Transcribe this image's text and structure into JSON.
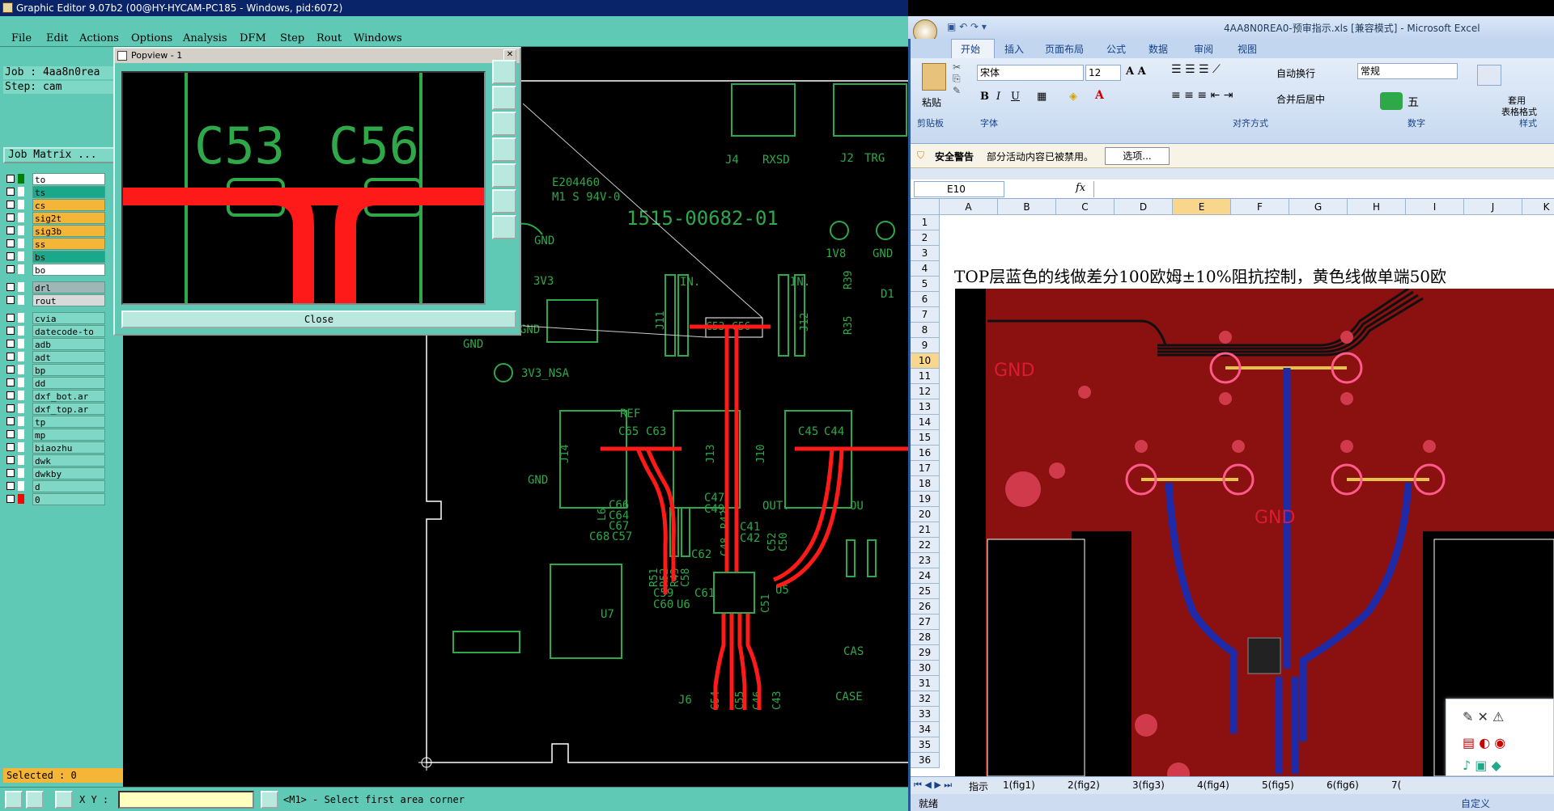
{
  "ge": {
    "title": "Graphic Editor 9.07b2 (00@HY-HYCAM-PC185 - Windows, pid:6072)",
    "menu": [
      "File",
      "Edit",
      "Actions",
      "Options",
      "Analysis",
      "DFM",
      "Step",
      "Rout",
      "Windows"
    ],
    "job": "Job : 4aa8n0rea",
    "step": "Step: cam",
    "job_matrix": "Job Matrix ...",
    "layers": [
      {
        "name": "to",
        "color": "#ffffff",
        "sw": "#008000"
      },
      {
        "name": "ts",
        "color": "#1aa88a",
        "sw": "#ffffff"
      },
      {
        "name": "cs",
        "color": "#f5b537",
        "sw": "#ffffff"
      },
      {
        "name": "sig2t",
        "color": "#f5b537",
        "sw": "#ffffff"
      },
      {
        "name": "sig3b",
        "color": "#f5b537",
        "sw": "#ffffff"
      },
      {
        "name": "ss",
        "color": "#f5b537",
        "sw": "#ffffff"
      },
      {
        "name": "bs",
        "color": "#1aa88a",
        "sw": "#ffffff"
      },
      {
        "name": "bo",
        "color": "#ffffff",
        "sw": "#ffffff"
      },
      {
        "name": "drl",
        "color": "#9eb6b6",
        "sw": "#ffffff"
      },
      {
        "name": "rout",
        "color": "#d9d9d9",
        "sw": "#ffffff"
      },
      {
        "name": "cvia",
        "color": "#7fd7c6",
        "sw": "#ffffff"
      },
      {
        "name": "datecode-to",
        "color": "#7fd7c6",
        "sw": "#ffffff"
      },
      {
        "name": "adb",
        "color": "#7fd7c6",
        "sw": "#ffffff"
      },
      {
        "name": "adt",
        "color": "#7fd7c6",
        "sw": "#ffffff"
      },
      {
        "name": "bp",
        "color": "#7fd7c6",
        "sw": "#ffffff"
      },
      {
        "name": "dd",
        "color": "#7fd7c6",
        "sw": "#ffffff"
      },
      {
        "name": "dxf_bot.ar",
        "color": "#7fd7c6",
        "sw": "#ffffff"
      },
      {
        "name": "dxf_top.ar",
        "color": "#7fd7c6",
        "sw": "#ffffff"
      },
      {
        "name": "tp",
        "color": "#7fd7c6",
        "sw": "#ffffff"
      },
      {
        "name": "mp",
        "color": "#7fd7c6",
        "sw": "#ffffff"
      },
      {
        "name": "biaozhu",
        "color": "#7fd7c6",
        "sw": "#ffffff"
      },
      {
        "name": "dwk",
        "color": "#7fd7c6",
        "sw": "#ffffff"
      },
      {
        "name": "dwkby",
        "color": "#7fd7c6",
        "sw": "#ffffff"
      },
      {
        "name": "d",
        "color": "#7fd7c6",
        "sw": "#ffffff"
      },
      {
        "name": "0",
        "color": "#7fd7c6",
        "sw": "#ff0000"
      }
    ],
    "selected": "Selected : 0",
    "xy_label": "X Y :",
    "prompt": "<M1> - Select first area corner",
    "popview_title": "Popview - 1",
    "popview_close": "Close",
    "pv_labels": [
      "C53",
      "C56"
    ],
    "board_labels": {
      "j4": "J4",
      "rxsd": "RXSD",
      "j2": "J2",
      "trg": "TRG",
      "pn": "1515-00682-01",
      "e2": "E204460",
      "m1": "M1 S 94V-0",
      "gnd1": "GND",
      "v1v8": "1V8",
      "gnd2": "GND",
      "v3v3": "3V3",
      "in1": "IN.",
      "in2": "IN.",
      "r39": "R39",
      "d1": "D1",
      "gnd3": "GND",
      "gnd4": "GND",
      "v3nsa": "3V3_NSA",
      "j11": "J11",
      "j12": "J12",
      "r35": "R35",
      "c53": "C53",
      "c56": "C56",
      "ref": "REF",
      "c65": "C65",
      "c63": "C63",
      "c45": "C45",
      "c44": "C44",
      "j14": "J14",
      "j13": "J13",
      "j10": "J10",
      "gnd5": "GND",
      "c66": "C66",
      "c64": "C64",
      "c67": "C67",
      "c68": "C68",
      "c57": "C57",
      "l6": "L6",
      "c47": "C47",
      "c49": "C49",
      "out": "OUT.",
      "ou": "OU",
      "c41": "C41",
      "c42": "C42",
      "c52": "C52",
      "c50": "C50",
      "c62": "C62",
      "c48": "C48",
      "r42": "R42",
      "r51": "R51",
      "r52": "R52",
      "r43": "R43",
      "c58": "C58",
      "c59": "C59",
      "c60": "C60",
      "u6": "U6",
      "c61": "C61",
      "c51": "C51",
      "u5": "U5",
      "u7": "U7",
      "c54": "C54",
      "c55": "C55",
      "c46": "C46",
      "c43": "C43",
      "j6": "J6",
      "cas": "CAS",
      "case": "CASE"
    }
  },
  "xl": {
    "title": "4AA8N0REA0-预审指示.xls [兼容模式] - Microsoft Excel",
    "tabs": [
      "开始",
      "插入",
      "页面布局",
      "公式",
      "数据",
      "审阅",
      "视图"
    ],
    "paste": "粘贴",
    "font_name": "宋体",
    "font_size": "12",
    "wrap": "自动换行",
    "merge": "合并后居中",
    "numfmt": "常规",
    "style_btn": "套用",
    "style_btn2": "表格格式",
    "groups": [
      "剪贴板",
      "字体",
      "对齐方式",
      "数字",
      "样式"
    ],
    "security_label": "安全警告",
    "security_text": "部分活动内容已被禁用。",
    "security_btn": "选项...",
    "namebox": "E10",
    "fx": "fx",
    "columns": [
      "A",
      "B",
      "C",
      "D",
      "E",
      "F",
      "G",
      "H",
      "I",
      "J",
      "K"
    ],
    "rows": [
      "1",
      "2",
      "3",
      "4",
      "5",
      "6",
      "7",
      "8",
      "9",
      "10",
      "11",
      "12",
      "13",
      "14",
      "15",
      "16",
      "17",
      "18",
      "19",
      "20",
      "21",
      "22",
      "23",
      "24",
      "25",
      "26",
      "27",
      "28",
      "29",
      "30",
      "31",
      "32",
      "33",
      "34",
      "35",
      "36"
    ],
    "note": "TOP层蓝色的线做差分100欧姆±10%阻抗控制，黄色线做单端50欧",
    "gnd1": "GND",
    "gnd2": "GND",
    "sheets": [
      "指示",
      "1(fig1)",
      "2(fig2)",
      "3(fig3)",
      "4(fig4)",
      "5(fig5)",
      "6(fig6)",
      "7("
    ],
    "status": "就绪",
    "ime_text": "五",
    "ime_label": "自定义"
  }
}
